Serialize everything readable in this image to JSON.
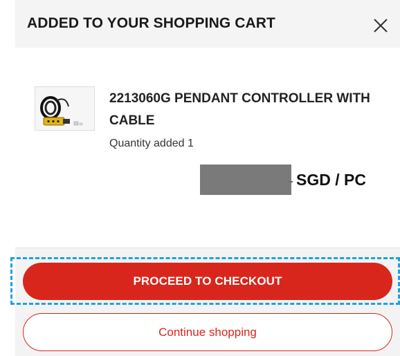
{
  "header": {
    "title": "ADDED TO YOUR SHOPPING CART",
    "close_icon": "close-icon"
  },
  "product": {
    "name": "2213060G PENDANT CONTROLLER WITH CABLE",
    "quantity_text": "Quantity added 1",
    "price_unit": "SGD / PC",
    "thumbnail_icon": "product-thumbnail"
  },
  "actions": {
    "checkout_label": "PROCEED TO CHECKOUT",
    "continue_label": "Continue shopping"
  },
  "colors": {
    "accent": "#d9261c",
    "focus": "#1aa3e0",
    "header_bg": "#f4f4f4"
  }
}
